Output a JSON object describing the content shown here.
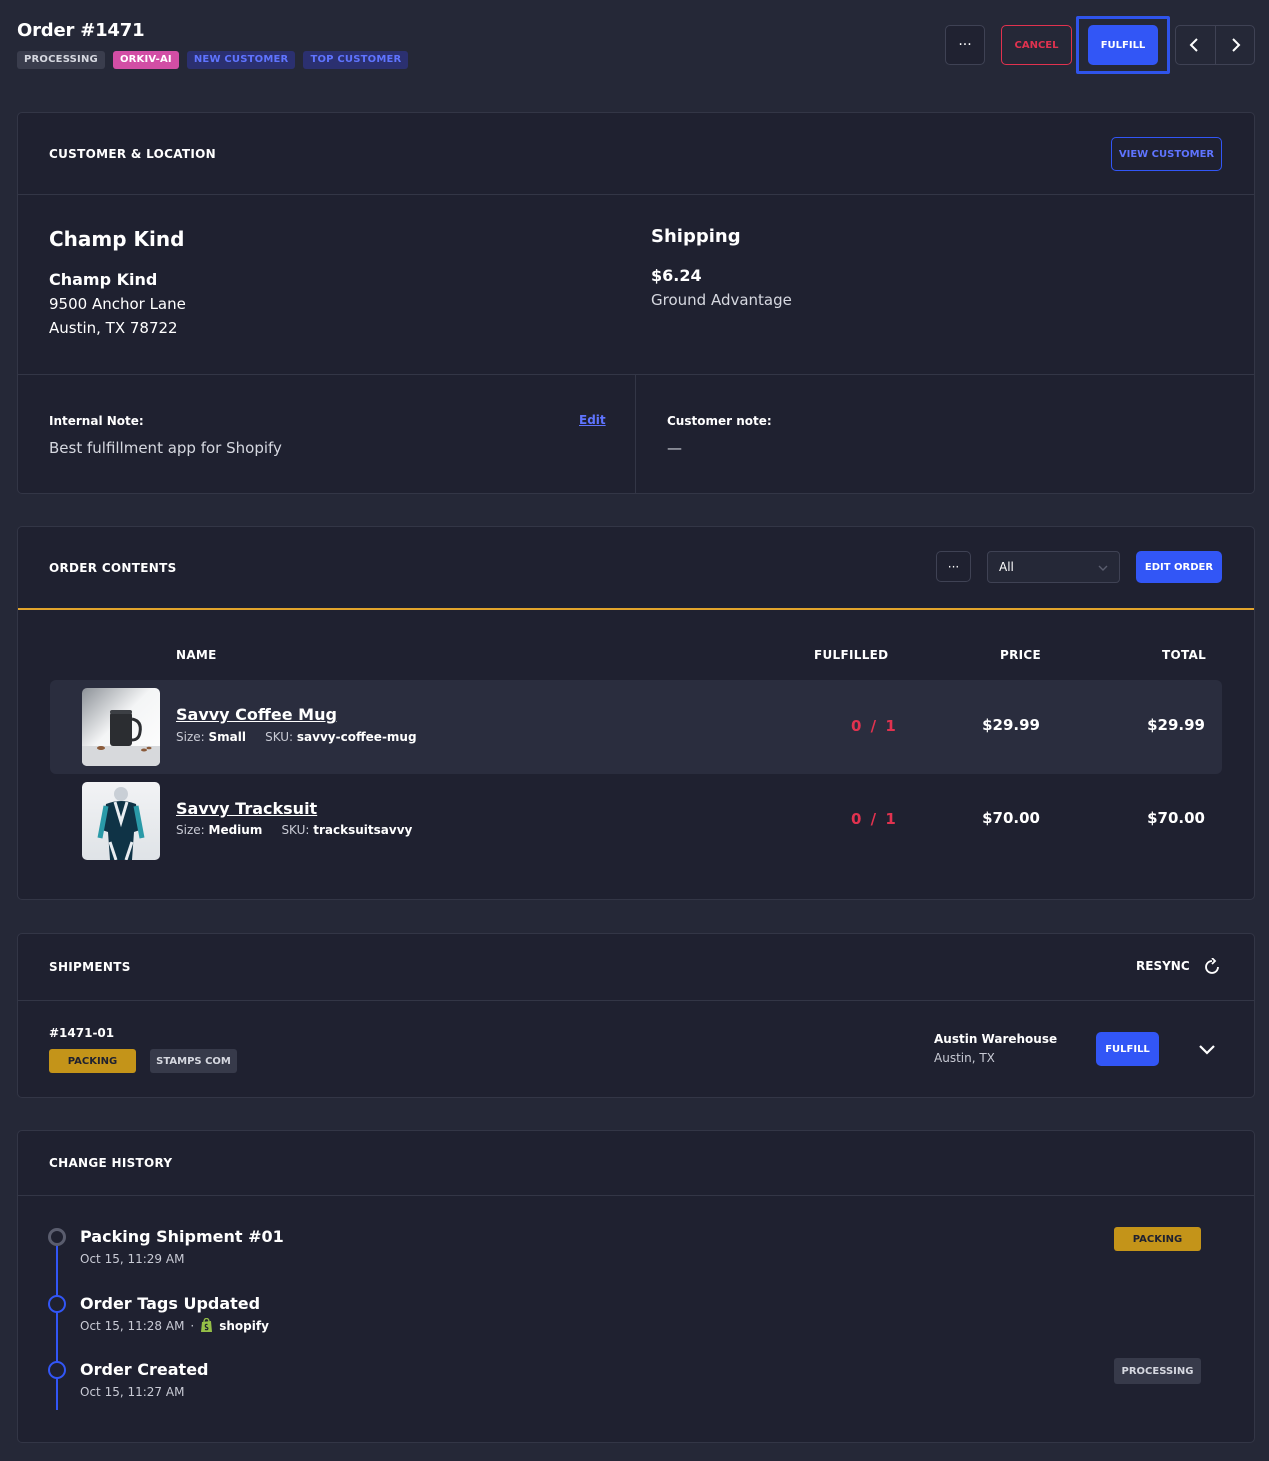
{
  "header": {
    "title": "Order #1471",
    "tags": [
      "PROCESSING",
      "ORKIV-AI",
      "NEW CUSTOMER",
      "TOP CUSTOMER"
    ],
    "more_label": "···",
    "cancel_label": "CANCEL",
    "fulfill_label": "FULFILL"
  },
  "customer": {
    "section_title": "CUSTOMER & LOCATION",
    "view_customer_label": "VIEW CUSTOMER",
    "name": "Champ Kind",
    "address_name": "Champ Kind",
    "address_line1": "9500 Anchor Lane",
    "address_line2": "Austin, TX 78722",
    "shipping_title": "Shipping",
    "shipping_price": "$6.24",
    "shipping_method": "Ground Advantage",
    "internal_note_label": "Internal Note:",
    "internal_note_edit": "Edit",
    "internal_note": "Best fulfillment app for Shopify",
    "customer_note_label": "Customer note:",
    "customer_note": "—"
  },
  "order_contents": {
    "section_title": "ORDER CONTENTS",
    "more_label": "···",
    "filter_value": "All",
    "edit_label": "EDIT ORDER",
    "columns": {
      "name": "NAME",
      "fulfilled": "FULFILLED",
      "price": "PRICE",
      "total": "TOTAL"
    },
    "items": [
      {
        "name": "Savvy Coffee Mug",
        "size_label": "Size:",
        "size": "Small",
        "sku_label": "SKU:",
        "sku": "savvy-coffee-mug",
        "fulfilled": "0 / 1",
        "price": "$29.99",
        "total": "$29.99"
      },
      {
        "name": "Savvy Tracksuit",
        "size_label": "Size:",
        "size": "Medium",
        "sku_label": "SKU:",
        "sku": "tracksuitsavvy",
        "fulfilled": "0 / 1",
        "price": "$70.00",
        "total": "$70.00"
      }
    ]
  },
  "shipments": {
    "section_title": "SHIPMENTS",
    "resync_label": "RESYNC",
    "items": [
      {
        "id": "#1471-01",
        "status": "PACKING",
        "carrier": "STAMPS COM",
        "warehouse": "Austin Warehouse",
        "location": "Austin, TX",
        "fulfill_label": "FULFILL"
      }
    ]
  },
  "history": {
    "section_title": "CHANGE HISTORY",
    "events": [
      {
        "title": "Packing Shipment #01",
        "time": "Oct 15, 11:29 AM",
        "badge": "PACKING"
      },
      {
        "title": "Order Tags Updated",
        "time": "Oct 15, 11:28 AM",
        "separator": "·",
        "source": "shopify"
      },
      {
        "title": "Order Created",
        "time": "Oct 15, 11:27 AM",
        "badge": "PROCESSING"
      }
    ]
  },
  "colors": {
    "accent": "#3256f6",
    "danger": "#e1324f",
    "warning": "#c49419",
    "tag_ai": "#d24ea5",
    "orange_rule": "#e2a42c"
  }
}
